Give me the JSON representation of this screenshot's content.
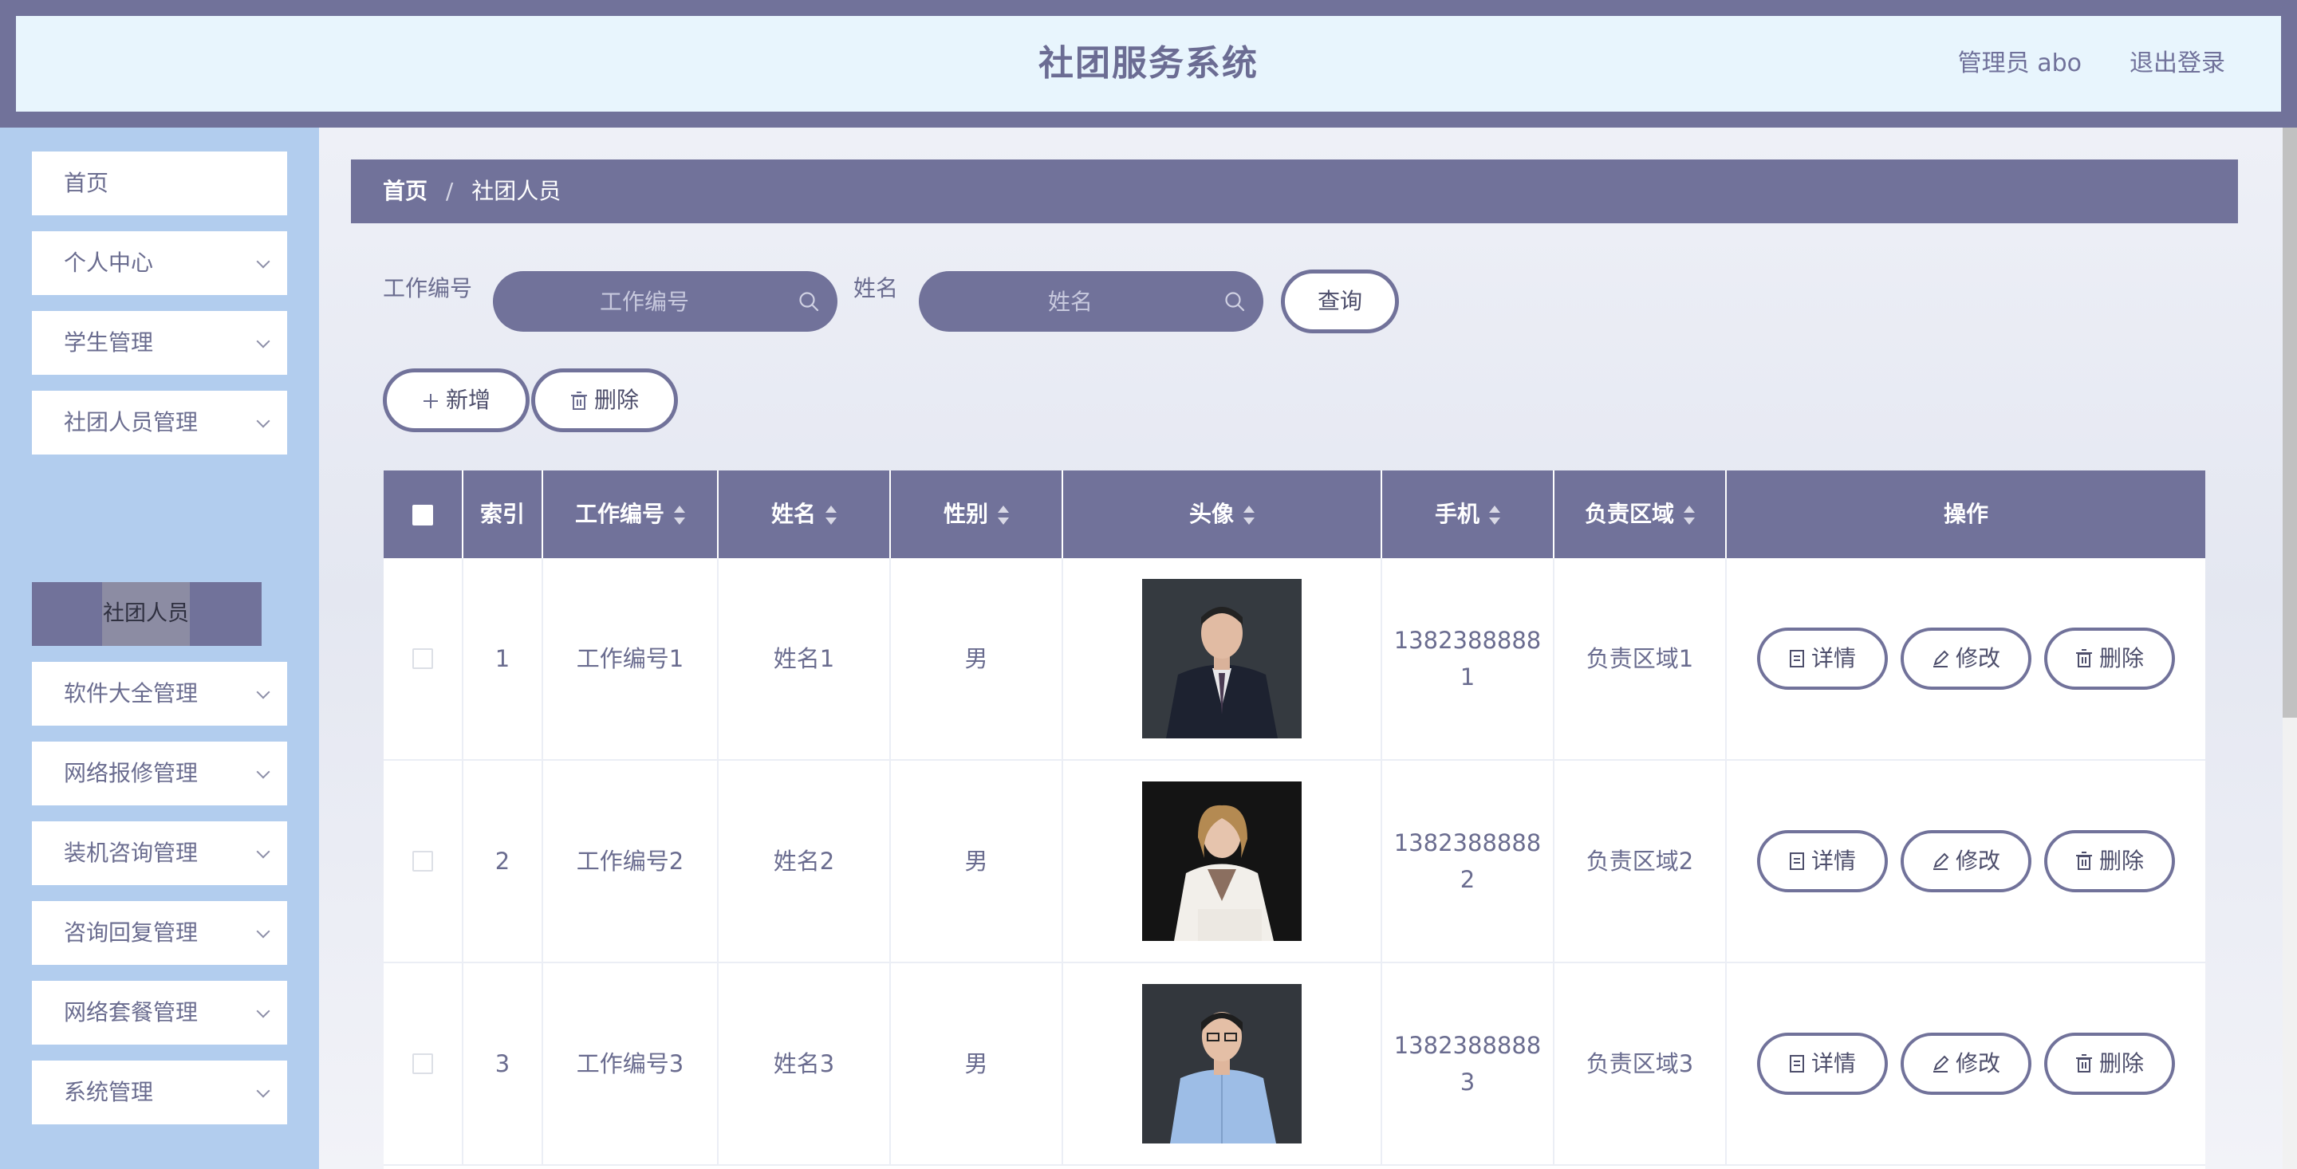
{
  "header": {
    "title": "社团服务系统",
    "user": "管理员 abo",
    "logout": "退出登录"
  },
  "sidebar": {
    "items": [
      {
        "label": "首页",
        "has_children": false
      },
      {
        "label": "个人中心",
        "has_children": true
      },
      {
        "label": "学生管理",
        "has_children": true
      },
      {
        "label": "社团人员管理",
        "has_children": true
      },
      {
        "label": "软件大全管理",
        "has_children": true
      },
      {
        "label": "网络报修管理",
        "has_children": true
      },
      {
        "label": "装机咨询管理",
        "has_children": true
      },
      {
        "label": "咨询回复管理",
        "has_children": true
      },
      {
        "label": "网络套餐管理",
        "has_children": true
      },
      {
        "label": "系统管理",
        "has_children": true
      }
    ],
    "active_submenu": "社团人员"
  },
  "breadcrumb": {
    "home": "首页",
    "separator": "/",
    "current": "社团人员"
  },
  "search": {
    "field1_label": "工作编号",
    "field1_placeholder": "工作编号",
    "field1_value": "",
    "field2_label": "姓名",
    "field2_placeholder": "姓名",
    "field2_value": "",
    "query_button": "查询"
  },
  "toolbar": {
    "add_label": "新增",
    "delete_label": "删除"
  },
  "table": {
    "columns": [
      "索引",
      "工作编号",
      "姓名",
      "性别",
      "头像",
      "手机",
      "负责区域",
      "操作"
    ],
    "rows": [
      {
        "index": "1",
        "job_no": "工作编号1",
        "name": "姓名1",
        "gender": "男",
        "phone_line1": "1382388888",
        "phone_line2": "1",
        "area": "负责区域1"
      },
      {
        "index": "2",
        "job_no": "工作编号2",
        "name": "姓名2",
        "gender": "男",
        "phone_line1": "1382388888",
        "phone_line2": "2",
        "area": "负责区域2"
      },
      {
        "index": "3",
        "job_no": "工作编号3",
        "name": "姓名3",
        "gender": "男",
        "phone_line1": "1382388888",
        "phone_line2": "3",
        "area": "负责区域3"
      }
    ],
    "actions": {
      "detail": "详情",
      "edit": "修改",
      "delete": "删除"
    }
  },
  "colors": {
    "primary": "#71729a",
    "sidebar_bg": "#b2cdee",
    "header_bg": "#e8f5fd",
    "text": "#6a6c8f"
  }
}
